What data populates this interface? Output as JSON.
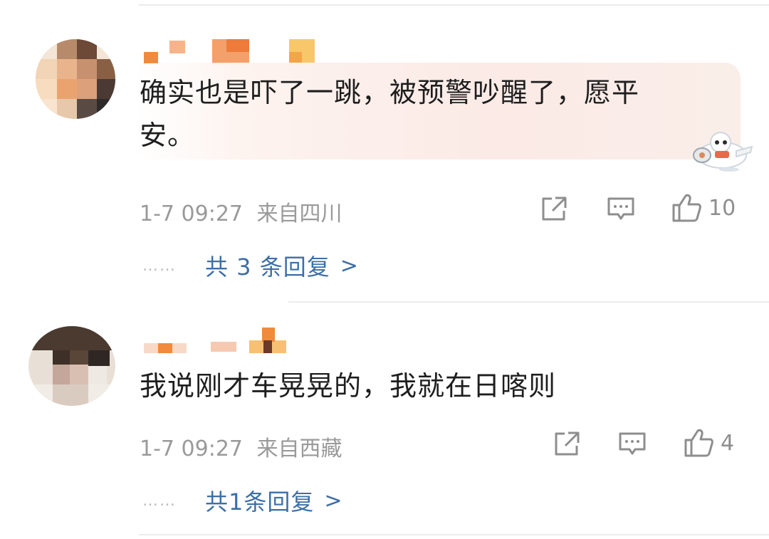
{
  "comments": [
    {
      "text": "确实也是吓了一跳，被预警吵醒了，愿平\n安。",
      "time": "1-7 09:27",
      "location": "来自四川",
      "likes": "10",
      "replies_label": "共 3 条回复",
      "replies_dots": "……",
      "chevron": ">"
    },
    {
      "text": "我说刚才车晃晃的，我就在日喀则",
      "time": "1-7 09:27",
      "location": "来自西藏",
      "likes": "4",
      "replies_label": "共1条回复",
      "replies_dots": "……",
      "chevron": ">"
    }
  ],
  "icons": {
    "repost": "repost-icon",
    "comment": "comment-icon",
    "like": "thumbs-up-icon",
    "sticker": "airplane-sticker-icon"
  },
  "colors": {
    "reply_link": "#3d6fa6",
    "meta_text": "#9a9a9a",
    "bubble": "#fbeae6"
  }
}
